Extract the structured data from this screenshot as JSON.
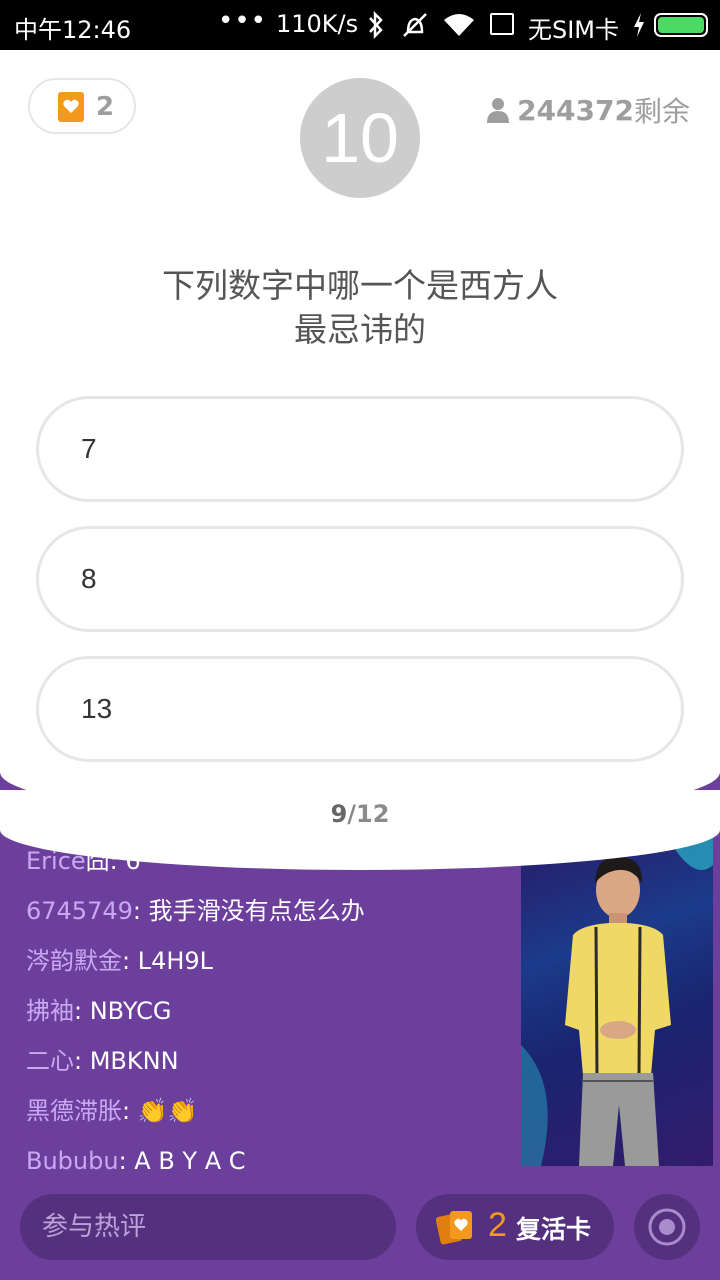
{
  "status_bar": {
    "time": "中午12:46",
    "dots": "•••",
    "speed": "110K/s",
    "sim": "无SIM卡"
  },
  "quiz": {
    "lives": "2",
    "timer": "10",
    "remaining_count": "244372",
    "remaining_suffix": "剩余",
    "question_line1": "下列数字中哪一个是西方人",
    "question_line2": "最忌讳的",
    "options": [
      "7",
      "8",
      "13"
    ],
    "progress_current": "9",
    "progress_total": "/12"
  },
  "chat": {
    "messages": [
      {
        "name": "Erice",
        "text": "囧: 6"
      },
      {
        "name": "6745749",
        "text": ": 我手滑没有点怎么办"
      },
      {
        "name": "涔韵默金",
        "text": ": L4H9L"
      },
      {
        "name": "拂袖",
        "text": ": NBYCG"
      },
      {
        "name": "二心",
        "text": ": MBKNN"
      },
      {
        "name": "黑德滞胀",
        "text": ": 👏👏"
      },
      {
        "name": "Bububu",
        "text": ": A B Y A C"
      }
    ]
  },
  "bottom_bar": {
    "comment_placeholder": "参与热评",
    "revive_count": "2",
    "revive_label": "复活卡"
  },
  "colors": {
    "background_purple": "#6c3f9d",
    "accent_orange": "#f39a1e",
    "chat_name": "#c9a8f2"
  }
}
